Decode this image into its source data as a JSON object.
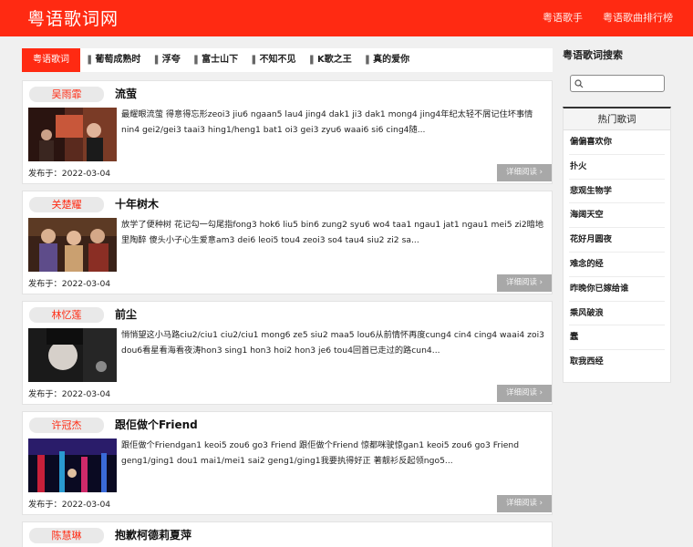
{
  "site": {
    "logo": "粤语歌词网"
  },
  "topnav": [
    "粤语歌手",
    "粤语歌曲排行榜"
  ],
  "tabs": {
    "active": "粤语歌词",
    "items": [
      "葡萄成熟时",
      "浮夸",
      "富士山下",
      "不知不见",
      "K歌之王",
      "真的爱你"
    ]
  },
  "posts": [
    {
      "artist": "吴雨霏",
      "title": "流萤",
      "excerpt": "最耀眼流萤 得意得忘形zeoi3 jiu6 ngaan5 lau4 jing4 dak1 ji3 dak1 mong4 jing4年纪太轻不屑记住坏事情nin4 gei2/gei3 taai3 hing1/heng1 bat1 oi3 gei3 zyu6 waai6 si6 cing4随...",
      "date": "发布于：2022-03-04",
      "more": "详细阅读"
    },
    {
      "artist": "关楚耀",
      "title": "十年树木",
      "excerpt": "放学了便种树 花记勾一勾尾指fong3 hok6 liu5 bin6 zung2 syu6 wo4 taa1 ngau1 jat1 ngau1 mei5 zi2暗地里陶醉 傻头小子心生爱意am3 dei6 leoi5 tou4 zeoi3 so4 tau4 siu2 zi2 sa...",
      "date": "发布于：2022-03-04",
      "more": "详细阅读"
    },
    {
      "artist": "林忆莲",
      "title": "前尘",
      "excerpt": "悄悄望这小马路ciu2/ciu1 ciu2/ciu1 mong6 ze5 siu2 maa5 lou6从前情怀再度cung4 cin4 cing4 waai4 zoi3 dou6看星看海看夜涛hon3 sing1 hon3 hoi2 hon3 je6 tou4回首已走过的路cun4...",
      "date": "发布于：2022-03-04",
      "more": "详细阅读"
    },
    {
      "artist": "许冠杰",
      "title": "跟佢做个Friend",
      "excerpt": "跟佢做个Friendgan1 keoi5 zou6 go3 Friend 跟佢做个Friend 惊都咪驶惊gan1 keoi5 zou6 go3 Friend geng1/ging1 dou1 mai1/mei1 sai2 geng1/ging1我要执得好正 著靓衫反起领ngo5...",
      "date": "发布于：2022-03-04",
      "more": "详细阅读"
    },
    {
      "artist": "陈慧琳",
      "title": "抱歉柯德莉夏萍",
      "excerpt": "",
      "date": "",
      "more": ""
    }
  ],
  "sidebar": {
    "search_title": "粤语歌词搜索",
    "search_placeholder": "",
    "hot_title": "热门歌词",
    "hot_items": [
      "偏偏喜欢你",
      "扑火",
      "悲观生物学",
      "海阔天空",
      "花好月圆夜",
      "难念的经",
      "昨晚你已嫁给谁",
      "乘风破浪",
      "蠢",
      "取我西经"
    ]
  },
  "colors": {
    "brand": "#ff2a12",
    "more_button": "#a8a8a8"
  }
}
